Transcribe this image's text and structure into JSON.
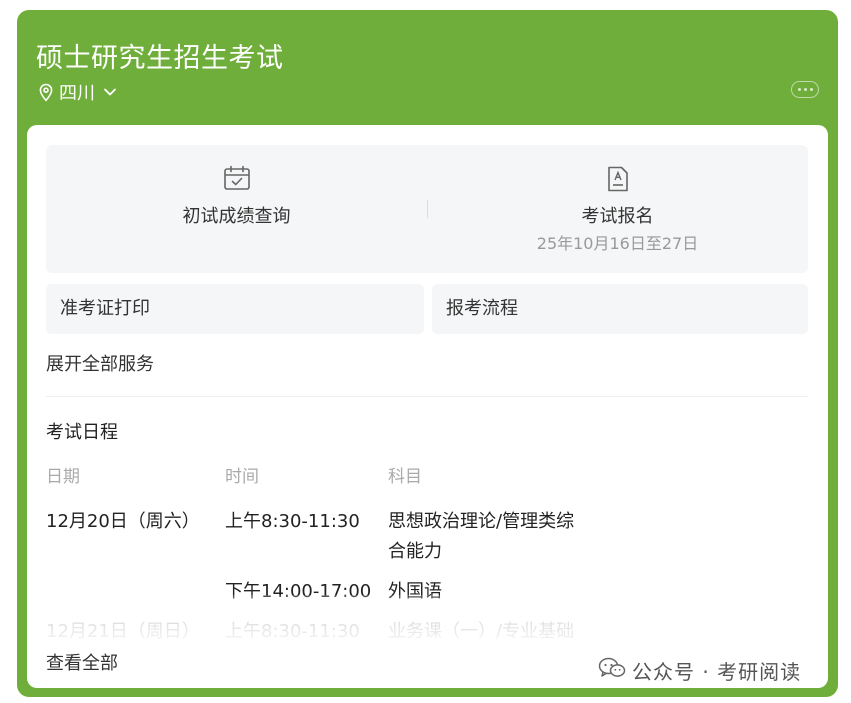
{
  "header": {
    "title": "硕士研究生招生考试",
    "region": "四川"
  },
  "services": {
    "score_query": "初试成绩查询",
    "registration": "考试报名",
    "registration_date": "25年10月16日至27日",
    "admit_card": "准考证打印",
    "process": "报考流程",
    "expand_all": "展开全部服务"
  },
  "schedule": {
    "title": "考试日程",
    "headers": {
      "date": "日期",
      "time": "时间",
      "subject": "科目"
    },
    "rows": [
      {
        "date": "12月20日（周六）",
        "time": "上午8:30-11:30",
        "subject": "思想政治理论/管理类综合能力"
      },
      {
        "date": "",
        "time": "下午14:00-17:00",
        "subject": "外国语"
      },
      {
        "date": "12月21日（周日）",
        "time": "上午8:30-11:30",
        "subject": "业务课（一）/专业基础"
      }
    ],
    "view_all": "查看全部"
  },
  "watermark": "公众号 · 考研阅读",
  "colors": {
    "header_green": "#6fae3a",
    "panel_gray": "#f5f6f7"
  }
}
